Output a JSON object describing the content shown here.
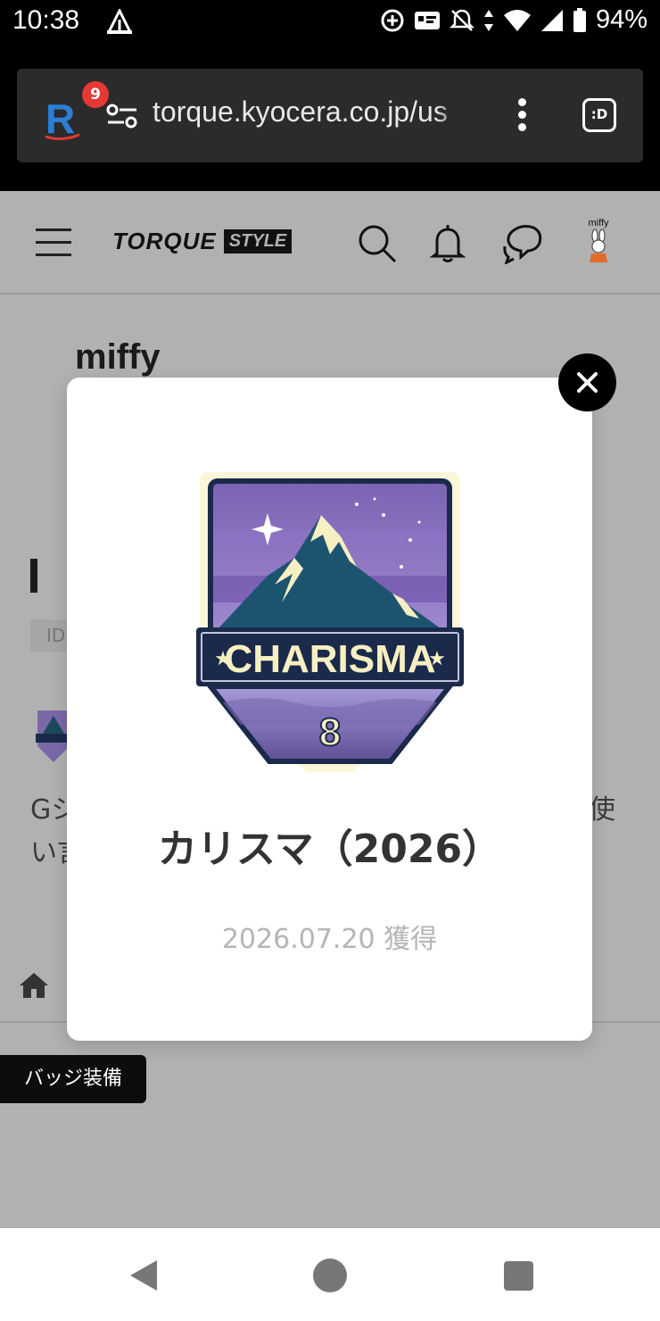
{
  "status_bar": {
    "time": "10:38",
    "battery": "94%",
    "icons": [
      "camp-icon",
      "data-saver-icon",
      "card-icon",
      "notifications-off-icon",
      "data-arrows-icon",
      "wifi-icon",
      "signal-icon",
      "battery-icon"
    ]
  },
  "browser": {
    "extension_badge": "9",
    "url": "torque.kyocera.co.jp/us",
    "tab_switcher_label": ":D"
  },
  "site_header": {
    "logo_main": "TORQUE",
    "logo_sub": "STYLE",
    "user_label": "miffy"
  },
  "background": {
    "username": "miffy",
    "id_label": "ID",
    "desc_line1": "Gシ",
    "desc_line1_end": "使",
    "desc_line2": "い言",
    "equip_button": "バッジ装備"
  },
  "modal": {
    "badge_word": "CHARISMA",
    "badge_number": "8",
    "title": "カリスマ（2026）",
    "date": "2026.07.20 獲得"
  },
  "colors": {
    "overlay_gray": "#b1b1b1",
    "badge_purple": "#8a6bb8",
    "badge_navy": "#1b2a4a",
    "notification_red": "#e53935"
  }
}
